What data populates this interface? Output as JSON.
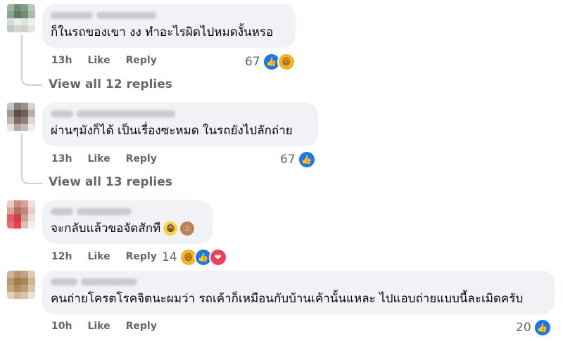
{
  "comments": [
    {
      "text": "ก็ในรถของเขา งง ทำอะไรผิดไปหมดงั้นหรอ",
      "time": "13h",
      "like_label": "Like",
      "reply_label": "Reply",
      "reaction_count": "67",
      "reactions": [
        "like-icon",
        "haha-icon"
      ],
      "view_replies": "View all 12 replies"
    },
    {
      "text": "ผ่านๆมังก็ได้ เป็นเรื่องซะหมด ในรถยังไปลักถ่าย",
      "time": "13h",
      "like_label": "Like",
      "reply_label": "Reply",
      "reaction_count": "67",
      "reactions": [
        "like-icon"
      ],
      "view_replies": "View all 13 replies"
    },
    {
      "text": "จะกลับแล้วขอจัดสักที",
      "text_emojis": [
        "grin-emoji",
        "see-no-evil-monkey-emoji"
      ],
      "time": "12h",
      "like_label": "Like",
      "reply_label": "Reply",
      "reaction_count": "14",
      "reactions": [
        "haha-icon",
        "like-icon",
        "love-icon"
      ]
    },
    {
      "text": "คนถ่ายโครตโรคจิตนะผมว่า รถเค้าก็เหมือนกับบ้านเค้านั้นแหละ ไปแอบถ่ายแบบนี้ละเมิดครับ",
      "time": "10h",
      "like_label": "Like",
      "reply_label": "Reply",
      "reaction_count": "20",
      "reactions": [
        "like-icon"
      ]
    }
  ],
  "colors": {
    "bubble": "#f0f2f5",
    "meta_text": "#65676b",
    "like_blue": "#1877f2",
    "love_red": "#f33e58",
    "haha_yellow": "#f7b125"
  }
}
